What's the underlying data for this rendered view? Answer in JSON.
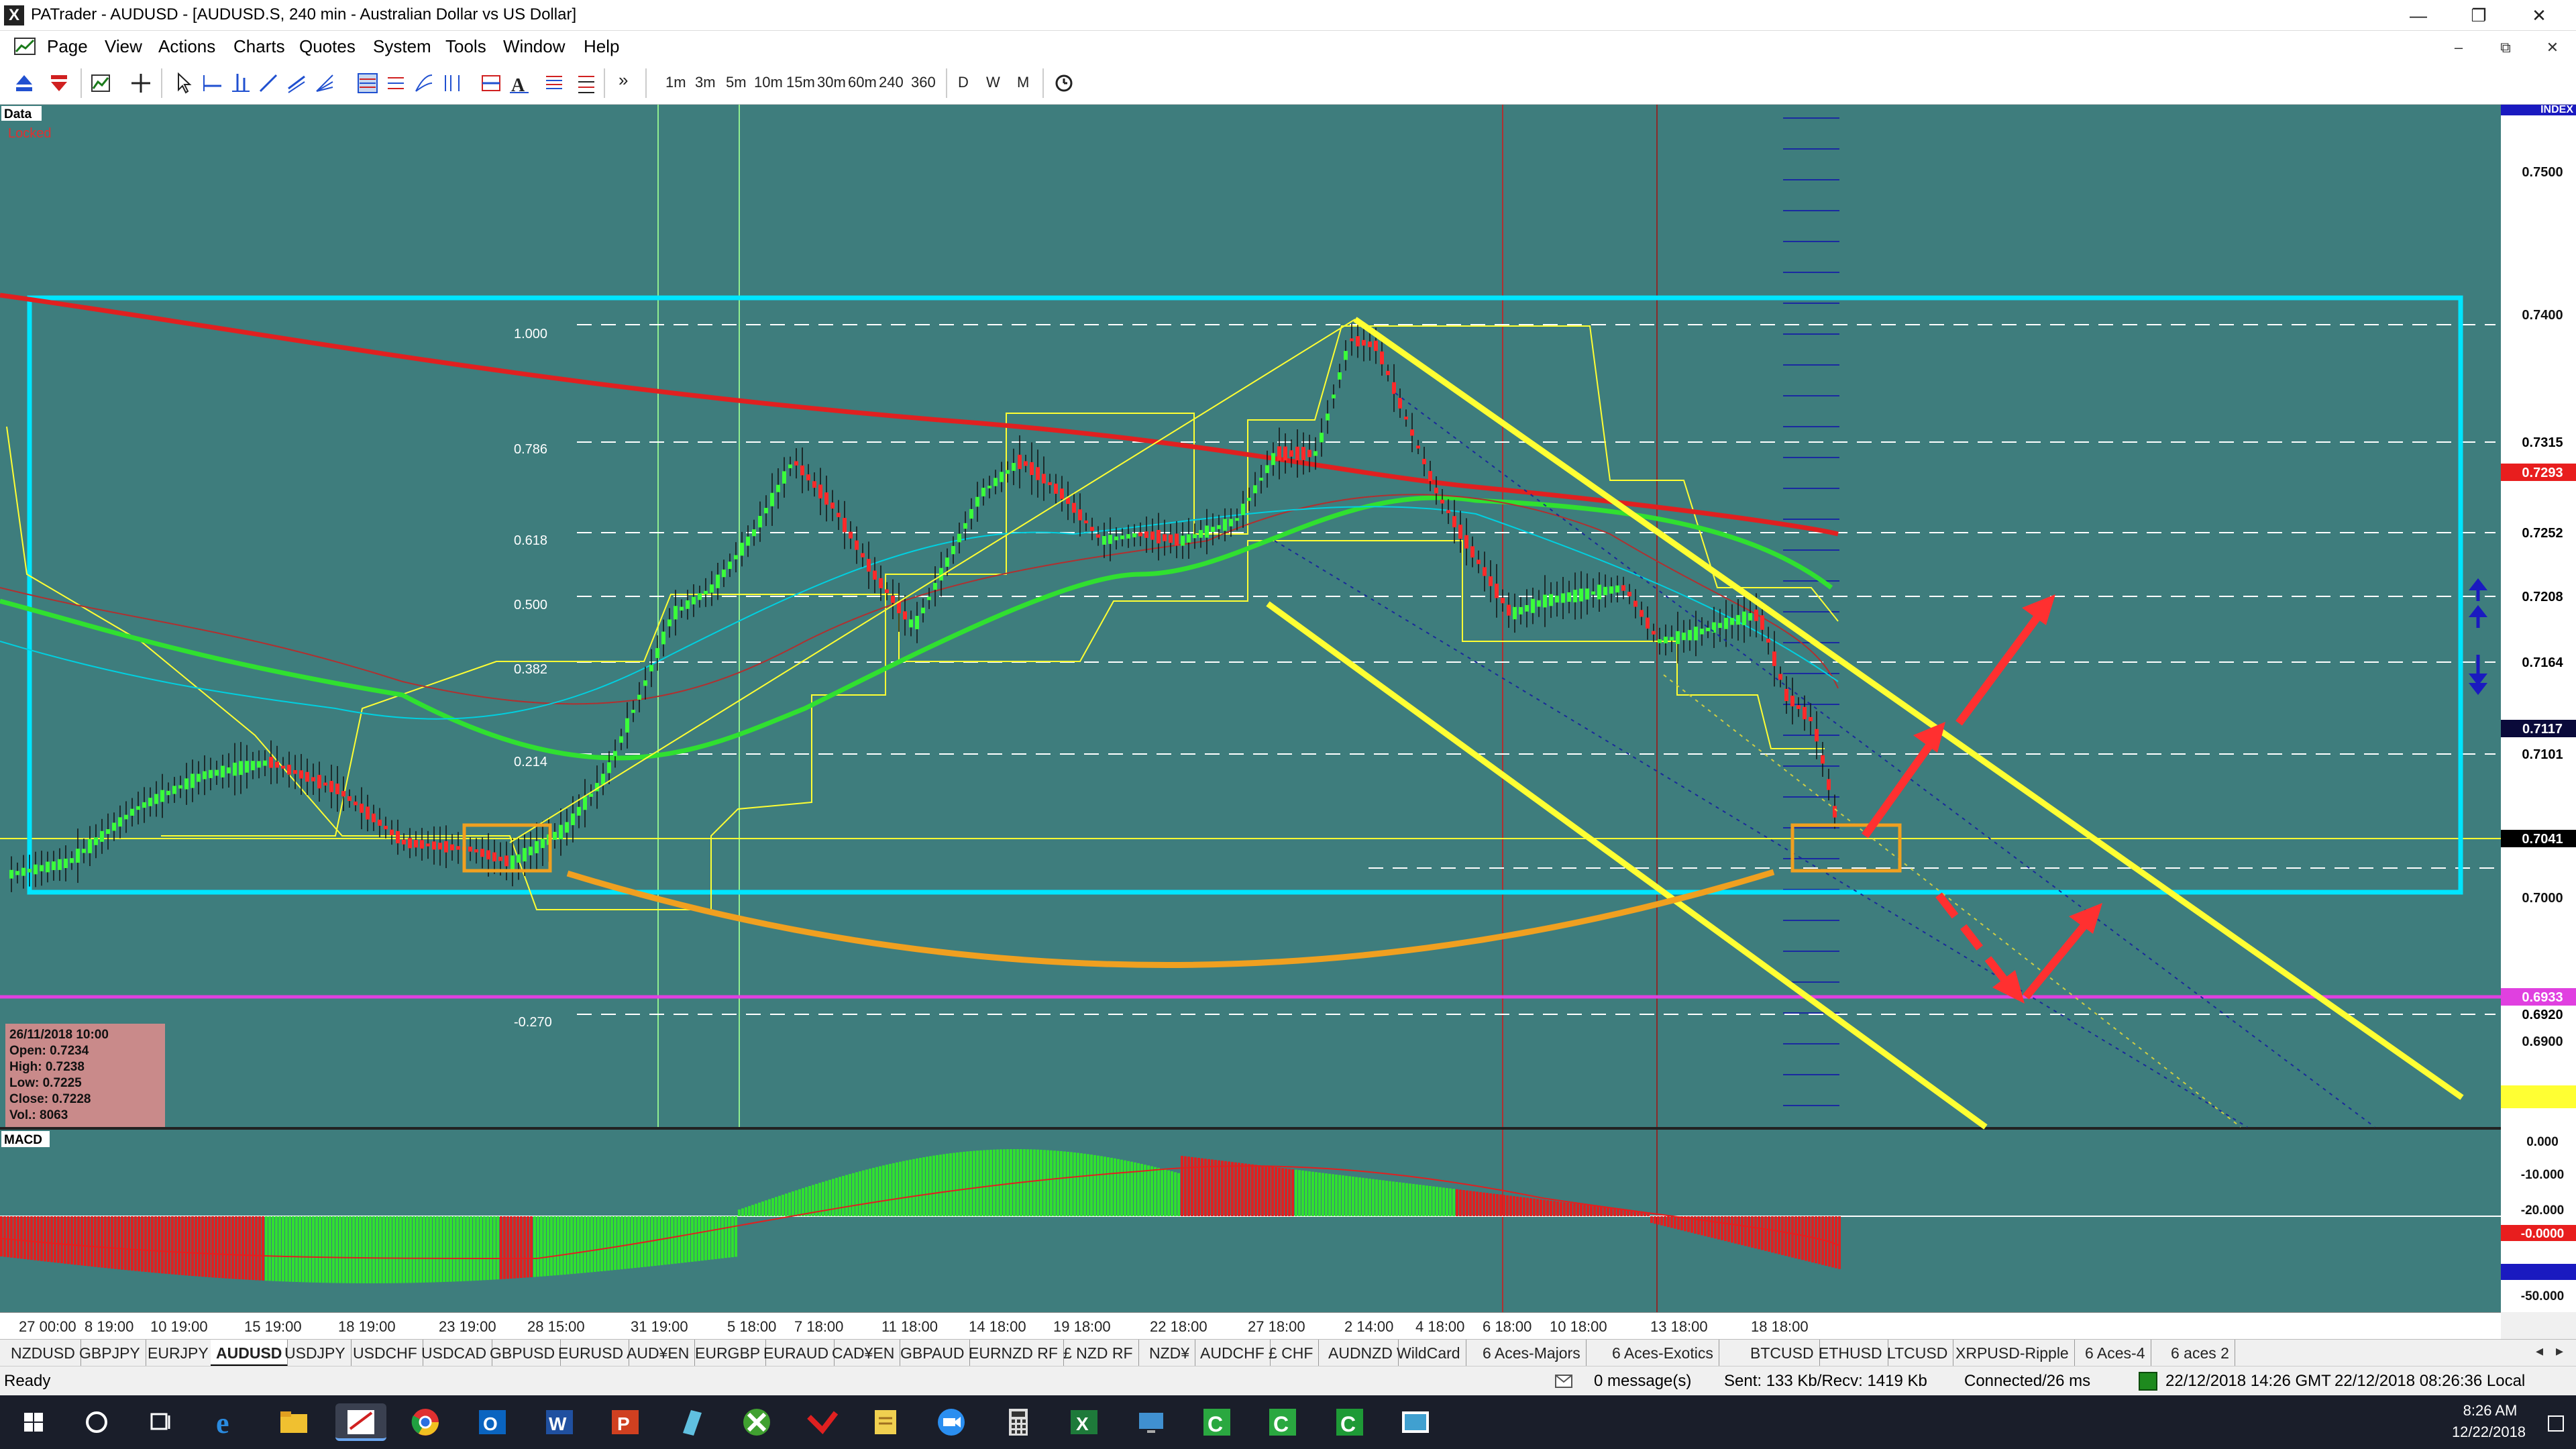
{
  "window": {
    "title": "PATrader - AUDUSD - [AUDUSD.S, 240 min - Australian Dollar vs US Dollar]",
    "app_icon": "X",
    "controls": [
      "—",
      "❐",
      "✕"
    ]
  },
  "menu": {
    "items": [
      "Page",
      "View",
      "Actions",
      "Charts",
      "Quotes",
      "System",
      "Tools",
      "Window",
      "Help"
    ],
    "mdi_controls": [
      "–",
      "⧉",
      "✕"
    ]
  },
  "toolbar": {
    "timeframes": [
      "1m",
      "3m",
      "5m",
      "10m",
      "15m",
      "30m",
      "60m",
      "240",
      "360"
    ],
    "periods": [
      "D",
      "W",
      "M"
    ],
    "overflow": "»"
  },
  "chart": {
    "data_label": "Data",
    "locked_label": "Locked",
    "index_label": "INDEX",
    "macd_label": "MACD",
    "price_axis": {
      "ticks": [
        "0.7500",
        "0.7400",
        "0.7000",
        "0.6900"
      ],
      "highlighted": [
        {
          "label": "0.7315",
          "bg": "#ffffff",
          "fg": "#000000"
        },
        {
          "label": "0.7293",
          "bg": "#e81e1e",
          "fg": "#ffffff"
        },
        {
          "label": "0.7252",
          "bg": "#ffffff",
          "fg": "#000000"
        },
        {
          "label": "0.7208",
          "bg": "#ffffff",
          "fg": "#000000"
        },
        {
          "label": "0.7164",
          "bg": "#ffffff",
          "fg": "#000000"
        },
        {
          "label": "0.7117",
          "bg": "#0a0a3a",
          "fg": "#ffffff"
        },
        {
          "label": "0.7101",
          "bg": "#ffffff",
          "fg": "#000000"
        },
        {
          "label": "0.7041",
          "bg": "#000000",
          "fg": "#ffffff"
        },
        {
          "label": "0.6933",
          "bg": "#e040e0",
          "fg": "#ffffff"
        },
        {
          "label": "0.6920",
          "bg": "#ffffff",
          "fg": "#000000"
        }
      ]
    },
    "fib_labels": [
      "1.000",
      "0.786",
      "0.618",
      "0.500",
      "0.382",
      "0.214",
      "-0.270"
    ],
    "macd_axis": [
      "0.000",
      "-10.000",
      "-20.000",
      "-0.0000",
      "-50.000"
    ],
    "time_axis": [
      "27 00:00",
      "8 19:00",
      "10 19:00",
      "15 19:00",
      "18 19:00",
      "23 19:00",
      "28 15:00",
      "31 19:00",
      "5 18:00",
      "7 18:00",
      "11 18:00",
      "14 18:00",
      "19 18:00",
      "22 18:00",
      "27 18:00",
      "2 14:00",
      "4 18:00",
      "6 18:00",
      "10 18:00",
      "13 18:00",
      "18 18:00"
    ],
    "info_box": {
      "date": "26/11/2018 10:00",
      "open": "Open: 0.7234",
      "high": "High: 0.7238",
      "low": "Low: 0.7225",
      "close": "Close: 0.7228",
      "vol": "Vol.: 8063"
    },
    "colors": {
      "background": "#3e7d7d",
      "cyan_box": "#00e5ff",
      "yellow": "#ffff33",
      "orange": "#f0a020",
      "red_arrow": "#ff3030",
      "ma_red": "#e02020",
      "ma_green": "#30e030",
      "magenta": "#e040e0"
    }
  },
  "symbol_tabs": [
    "NZDUSD",
    "GBPJPY",
    "EURJPY",
    "AUDUSD",
    "USDJPY",
    "USDCHF",
    "USDCAD",
    "GBPUSD",
    "EURUSD",
    "AUD¥EN",
    "EURGBP",
    "EURAUD",
    "CAD¥EN",
    "GBPAUD",
    "EURNZD RF",
    "£ NZD RF",
    "NZD¥",
    "AUDCHF",
    "£ CHF",
    "AUDNZD",
    "WildCard",
    "6 Aces-Majors",
    "6 Aces-Exotics",
    "BTCUSD",
    "ETHUSD",
    "LTCUSD",
    "XRPUSD-Ripple",
    "6 Aces-4",
    "6 aces 2"
  ],
  "active_tab": "AUDUSD",
  "status": {
    "ready": "Ready",
    "messages": "0 message(s)",
    "traffic": "Sent: 133 Kb/Recv: 1419 Kb",
    "connection": "Connected/26 ms",
    "gmt_time": "22/12/2018 14:26 GMT",
    "local_time": "22/12/2018 08:26:36 Local"
  },
  "taskbar": {
    "clock_time": "8:26 AM",
    "clock_date": "12/22/2018"
  }
}
